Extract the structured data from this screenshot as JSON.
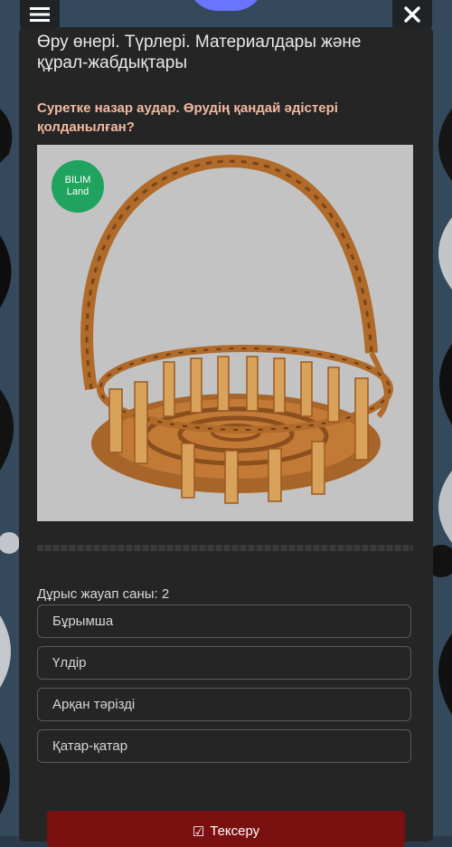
{
  "header": {
    "menu_icon": "hamburger-menu-icon",
    "close_icon": "close-icon"
  },
  "lesson": {
    "title": "Өру өнері. Түрлері. Материалдары және құрал-жабдықтары"
  },
  "question": {
    "text": "Суретке назар аудар. Өрудің қандай әдістері қолданылған?",
    "image_logo_line1": "BILIM",
    "image_logo_line2": "Land"
  },
  "answers": {
    "count_label": "Дұрыс жауап саны: 2",
    "options": [
      "Бұрымша",
      "Үлдір",
      "Арқан тәрізді",
      "Қатар-қатар"
    ]
  },
  "actions": {
    "check_label": "Тексеру",
    "check_icon": "checkbox-check-icon"
  },
  "colors": {
    "card": "#252525",
    "question": "#f2b9a0",
    "check_button": "#7a1010",
    "logo": "#1fa35f"
  }
}
